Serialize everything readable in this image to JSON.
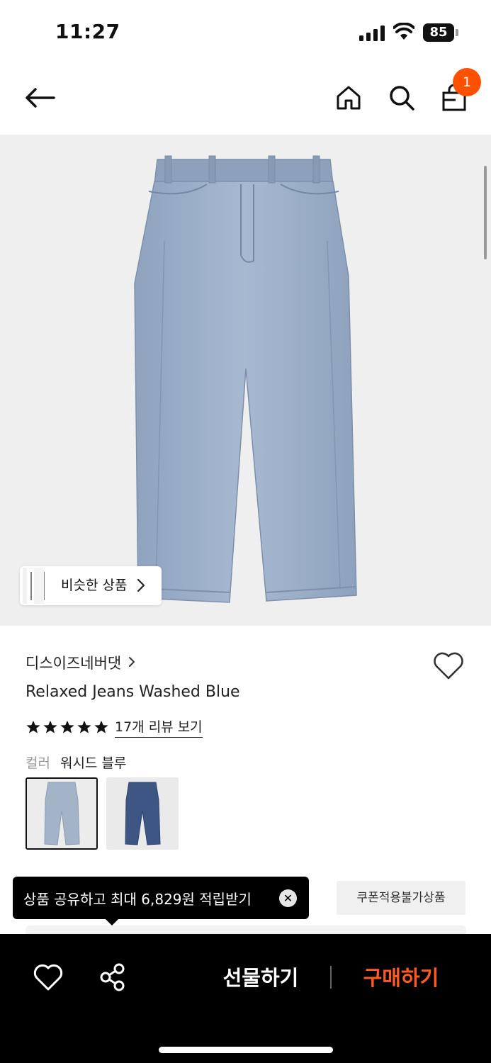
{
  "status_bar": {
    "time": "11:27",
    "battery": "85"
  },
  "nav": {
    "cart_count": "1",
    "icons": [
      "back-arrow-icon",
      "home-icon",
      "search-icon",
      "cart-icon"
    ]
  },
  "product": {
    "similar_label": "비슷한 상품",
    "brand": "디스이즈네버댓",
    "name": "Relaxed Jeans Washed Blue",
    "rating_stars": 5,
    "review_link": "17개 리뷰 보기",
    "color_label": "컬러",
    "color_value": "워시드 블루",
    "swatches": [
      "washed-blue-jeans",
      "dark-blue-jeans"
    ]
  },
  "tooltip": {
    "text": "상품 공유하고 최대 6,829원 적립받기",
    "close": "✕"
  },
  "coupon_chip": "쿠폰적용불가상품",
  "bottom_bar": {
    "gift_label": "선물하기",
    "buy_label": "구매하기"
  },
  "colors": {
    "accent": "#ff5000",
    "buy": "#ff5a1f",
    "bar": "#000000",
    "image_bg": "#efefef",
    "denim": "#9db0c9"
  }
}
